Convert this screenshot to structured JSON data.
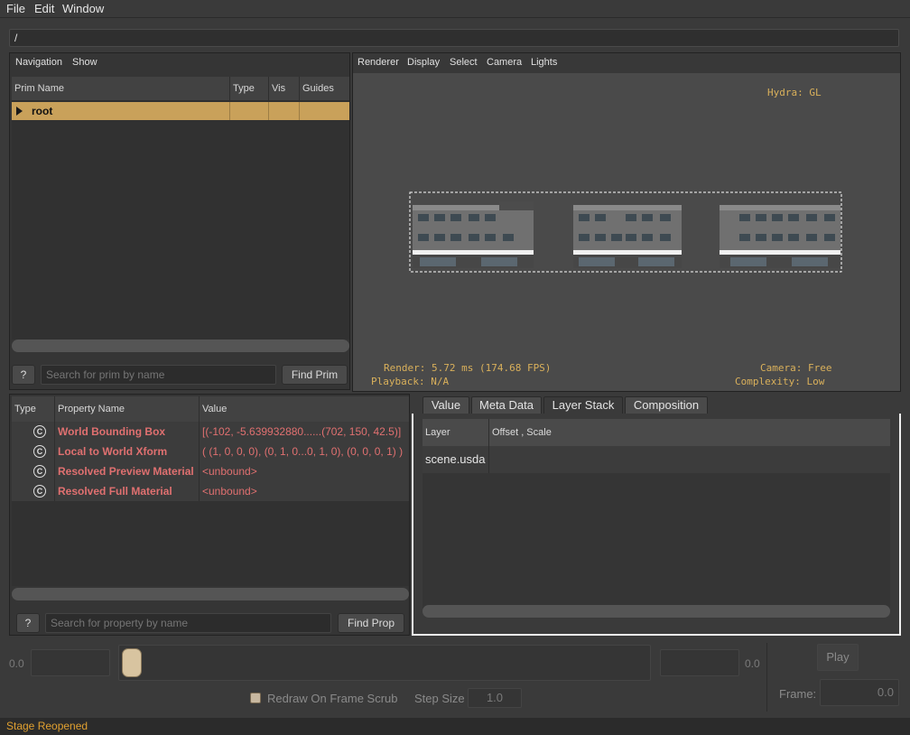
{
  "menu": {
    "file": "File",
    "edit": "Edit",
    "window": "Window"
  },
  "path": "/",
  "prim_panel": {
    "menu": {
      "navigation": "Navigation",
      "show": "Show"
    },
    "columns": {
      "prim_name": "Prim Name",
      "type": "Type",
      "vis": "Vis",
      "guides": "Guides"
    },
    "root_row": {
      "name": "root"
    },
    "help_button": "?",
    "search_placeholder": "Search for prim by name",
    "find_button": "Find Prim"
  },
  "viewport": {
    "menu": {
      "renderer": "Renderer",
      "display": "Display",
      "select": "Select",
      "camera": "Camera",
      "lights": "Lights"
    },
    "hud": {
      "hydra": "Hydra: GL",
      "render": "Render: 5.72 ms (174.68 FPS)",
      "playback": "Playback: N/A",
      "camera": "Camera: Free",
      "complexity": "Complexity: Low"
    }
  },
  "property_panel": {
    "columns": {
      "type": "Type",
      "property_name": "Property Name",
      "value": "Value"
    },
    "rows": [
      {
        "icon": "C",
        "name": "World Bounding Box",
        "value": "[(-102, -5.639932880......(702, 150, 42.5)]"
      },
      {
        "icon": "C",
        "name": "Local to World Xform",
        "value": "( (1, 0, 0, 0), (0, 1, 0...0, 1, 0), (0, 0, 0, 1) )"
      },
      {
        "icon": "C",
        "name": "Resolved Preview Material",
        "value": "<unbound>"
      },
      {
        "icon": "C",
        "name": "Resolved Full Material",
        "value": "<unbound>"
      }
    ],
    "help_button": "?",
    "search_placeholder": "Search for property by name",
    "find_button": "Find Prop"
  },
  "tabs": {
    "items": {
      "value": "Value",
      "meta": "Meta Data",
      "layer_stack": "Layer Stack",
      "composition": "Composition"
    },
    "active": "Layer Stack",
    "layer_table": {
      "columns": {
        "layer": "Layer",
        "offset": "Offset , Scale"
      },
      "rows": [
        {
          "layer": "scene.usda",
          "offset": ""
        }
      ]
    }
  },
  "timeline": {
    "start_value": "0.0",
    "end_value": "0.0",
    "play_button": "Play",
    "redraw_label": "Redraw On Frame Scrub",
    "redraw_checked": false,
    "step_size_label": "Step Size",
    "step_size_value": "1.0",
    "frame_label": "Frame:",
    "frame_value": "0.0"
  },
  "status": {
    "message": "Stage Reopened",
    "color": "#e0a030"
  },
  "colors": {
    "selection": "#c9a15a",
    "hud": "#d9b05b",
    "property_text": "#e07070"
  }
}
